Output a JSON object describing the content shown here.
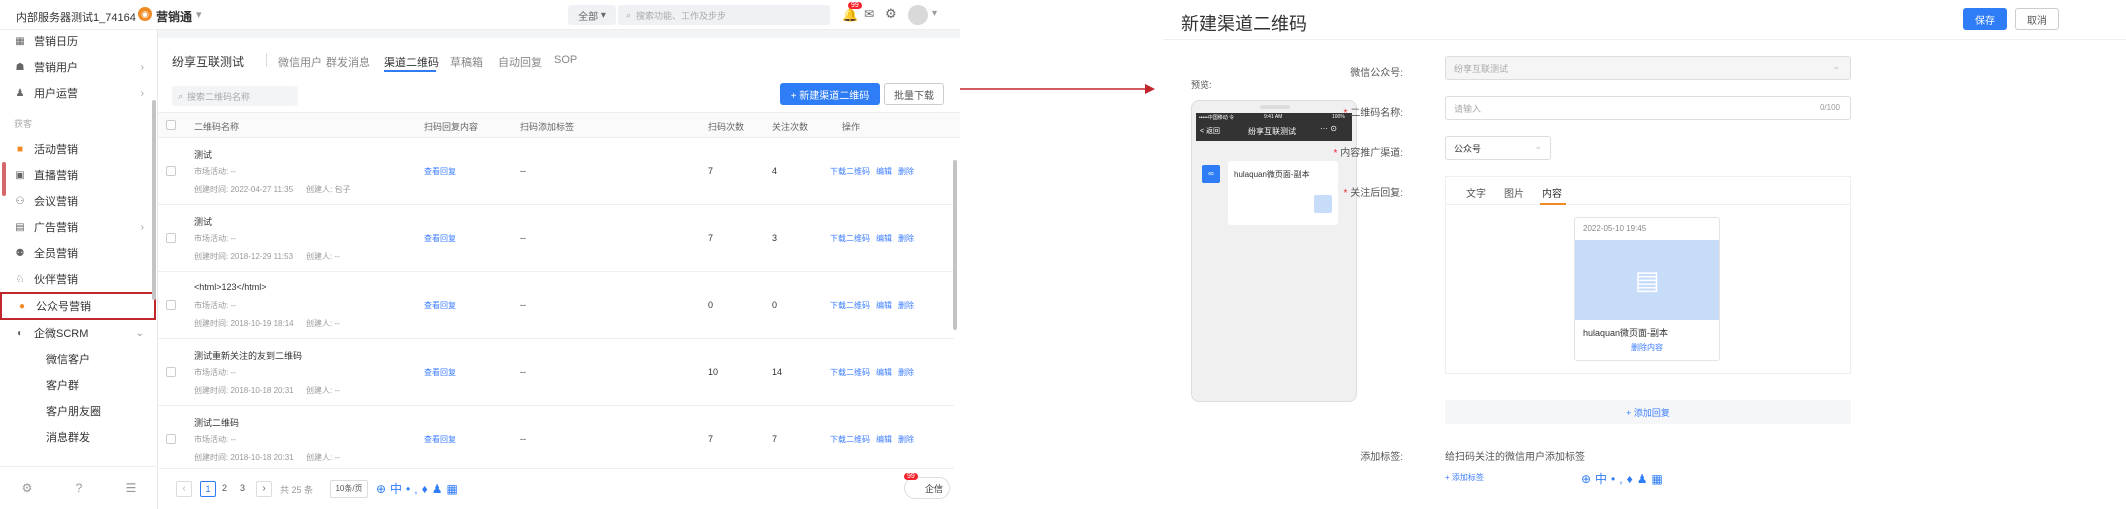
{
  "topbar": {
    "tenant": "内部服务器测试1_74164",
    "app_name": "营销通",
    "filter_all": "全部",
    "search_placeholder": "搜索功能、工作及步步",
    "notif_count": "99"
  },
  "sidebar": {
    "items": [
      {
        "label": "营销日历"
      },
      {
        "label": "营销用户"
      },
      {
        "label": "用户运营"
      },
      {
        "label": "获客"
      },
      {
        "label": "活动营销"
      },
      {
        "label": "直播营销"
      },
      {
        "label": "会议营销"
      },
      {
        "label": "广告营销"
      },
      {
        "label": "全员营销"
      },
      {
        "label": "伙伴营销"
      },
      {
        "label": "公众号营销"
      },
      {
        "label": "企微SCRM"
      },
      {
        "label": "微信客户"
      },
      {
        "label": "客户群"
      },
      {
        "label": "客户朋友圈"
      },
      {
        "label": "消息群发"
      }
    ]
  },
  "page": {
    "account_name": "纷享互联测试",
    "tabs": [
      "微信用户",
      "群发消息",
      "渠道二维码",
      "草稿箱",
      "自动回复",
      "SOP"
    ],
    "search_placeholder": "搜索二维码名称",
    "new_button": "+ 新建渠道二维码",
    "export_button": "批量下载",
    "columns": [
      "二维码名称",
      "扫码回复内容",
      "扫码添加标签",
      "扫码次数",
      "关注次数",
      "操作"
    ],
    "rows": [
      {
        "name": "测试",
        "activity": "市场活动:  --",
        "created": "创建时间:  2022-04-27 11:35",
        "creator": "创建人:  包子",
        "reply": "查看回复",
        "tag": "--",
        "scans": "7",
        "follows": "4"
      },
      {
        "name": "测试",
        "activity": "市场活动:  --",
        "created": "创建时间:  2018-12-29 11:53",
        "creator": "创建人:  --",
        "reply": "查看回复",
        "tag": "--",
        "scans": "7",
        "follows": "3"
      },
      {
        "name": "<html>123</html>",
        "activity": "市场活动:  --",
        "created": "创建时间:  2018-10-19 18:14",
        "creator": "创建人:  --",
        "reply": "查看回复",
        "tag": "--",
        "scans": "0",
        "follows": "0"
      },
      {
        "name": "测试重新关注的友到二维码",
        "activity": "市场活动:  --",
        "created": "创建时间:  2018-10-18 20:31",
        "creator": "创建人:  --",
        "reply": "查看回复",
        "tag": "--",
        "scans": "10",
        "follows": "14"
      },
      {
        "name": "测试二维码",
        "activity": "市场活动:  --",
        "created": "创建时间:  2018-10-18 20:31",
        "creator": "创建人:  --",
        "reply": "查看回复",
        "tag": "--",
        "scans": "7",
        "follows": "7"
      }
    ],
    "ops": [
      "下载二维码",
      "编辑",
      "删除"
    ],
    "pagination": {
      "pages": [
        "1",
        "2",
        "3"
      ],
      "total": "共 25 条",
      "page_size": "10条/页"
    },
    "chat_badge": "99",
    "chat_label": "企信"
  },
  "modal": {
    "title": "新建渠道二维码",
    "save": "保存",
    "cancel": "取消",
    "preview_label": "预览:",
    "phone": {
      "status_left": "•••••中国移动 令",
      "status_time": "9:41 AM",
      "status_right": "100%",
      "back": "< 返回",
      "title": "纷享互联测试",
      "msg_title": "hulaquan微页面-副本"
    },
    "fields": {
      "account_label": "微信公众号:",
      "account_value": "纷享互联测试",
      "name_label": "二维码名称:",
      "name_placeholder": "请输入",
      "name_counter": "0/100",
      "channel_label": "内容推广渠道:",
      "channel_value": "公众号",
      "reply_label": "关注后回复:",
      "reply_tabs": [
        "文字",
        "图片",
        "内容"
      ],
      "card_date": "2022-05-10 19:45",
      "card_title": "hulaquan微页面-副本",
      "card_delete": "删除内容",
      "add_reply": "+ 添加回复",
      "tag_label": "添加标签:",
      "tag_desc": "给扫码关注的微信用户添加标签",
      "add_tag": "+ 添加标签"
    }
  },
  "colors": {
    "accent": "#2e7cf6",
    "highlight": "#c0272d",
    "brand_orange": "#f08a24"
  }
}
